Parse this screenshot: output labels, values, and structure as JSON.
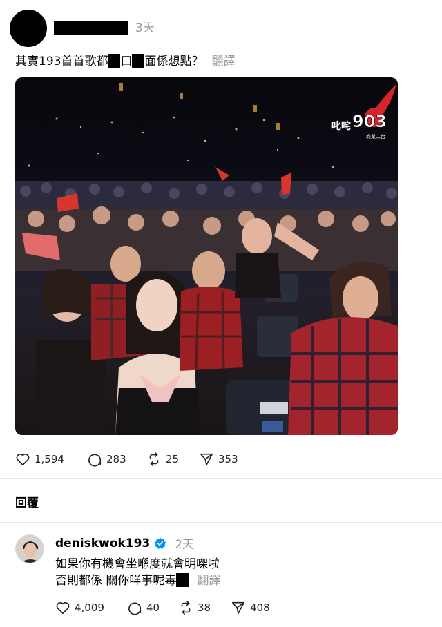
{
  "post": {
    "time": "3天",
    "text_prefix": "其實193首首歌都",
    "text_mid": "口",
    "text_suffix": "面係想點？",
    "translate_label": "翻譯",
    "media": {
      "watermark_text": "叱咤",
      "watermark_number": "903",
      "watermark_sub": "商業二台"
    },
    "actions": {
      "likes": "1,594",
      "comments": "283",
      "reposts": "25",
      "shares": "353"
    }
  },
  "replies_section": {
    "title": "回覆"
  },
  "reply": {
    "username": "deniskwok193",
    "time": "2天",
    "line1": "如果你有機會坐喺度就會明㗎啦",
    "line2_prefix": "否則都係 關你咩事呢毒",
    "translate_label": "翻譯",
    "actions": {
      "likes": "4,009",
      "comments": "40",
      "reposts": "38",
      "shares": "408"
    }
  },
  "colors": {
    "accent_red": "#d8232a",
    "muted_text": "#999999",
    "verified_blue": "#0095f6"
  },
  "icons": [
    "heart-icon",
    "comment-icon",
    "repost-icon",
    "share-icon",
    "verified-icon"
  ]
}
